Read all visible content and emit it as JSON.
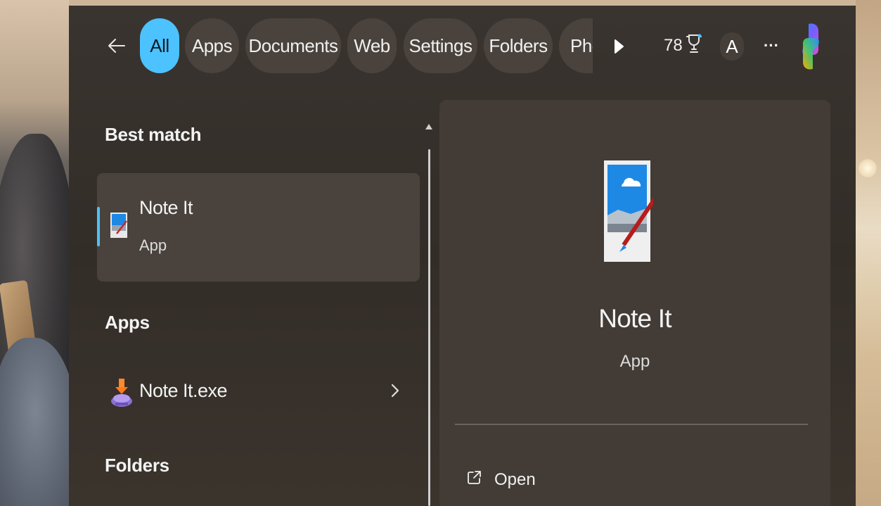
{
  "filters": {
    "back_icon": "back-arrow-icon",
    "chips": [
      {
        "label": "All",
        "active": true
      },
      {
        "label": "Apps",
        "active": false
      },
      {
        "label": "Documents",
        "active": false
      },
      {
        "label": "Web",
        "active": false
      },
      {
        "label": "Settings",
        "active": false
      },
      {
        "label": "Folders",
        "active": false
      },
      {
        "label": "Pho",
        "active": false
      }
    ],
    "more_icon": "play-right-icon"
  },
  "header": {
    "points": "78",
    "trophy_icon": "trophy-icon",
    "avatar_letter": "A",
    "ellipsis": "···",
    "copilot_icon": "copilot-icon"
  },
  "results": {
    "best_match": {
      "section_title": "Best match",
      "name": "Note It",
      "type": "App",
      "icon": "note-it-app-icon"
    },
    "apps": {
      "section_title": "Apps",
      "items": [
        {
          "name": "Note It.exe",
          "icon": "installer-exe-icon"
        }
      ]
    },
    "folders": {
      "section_title": "Folders"
    }
  },
  "details": {
    "name": "Note It",
    "type": "App",
    "actions": [
      {
        "label": "Open",
        "icon": "open-external-icon"
      }
    ]
  },
  "colors": {
    "accent": "#4cc2ff",
    "panel": "#3a3430",
    "card": "#4a433d"
  }
}
